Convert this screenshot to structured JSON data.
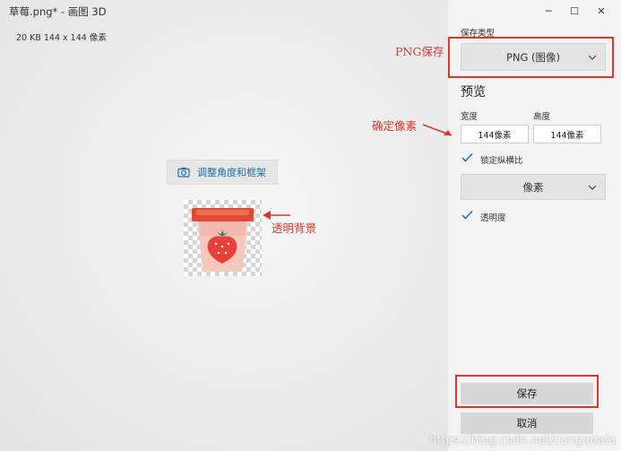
{
  "window": {
    "title": "草莓.png* - 画图 3D",
    "file_info": "20 KB   144 x 144 像素",
    "controls": {
      "minimize": "─",
      "maximize": "☐",
      "close": "✕"
    }
  },
  "canvas": {
    "crop_button_label": "调整角度和框架",
    "crop_button_icon": "camera-icon"
  },
  "panel": {
    "save_type_label": "保存类型",
    "save_type_value": "PNG (图像)",
    "preview_heading": "预览",
    "width_label": "宽度",
    "height_label": "高度",
    "width_value": "144像素",
    "height_value": "144像素",
    "lock_aspect_label": "锁定纵横比",
    "lock_aspect_checked": true,
    "unit_value": "像素",
    "transparency_label": "透明度",
    "transparency_checked": true,
    "save_button": "保存",
    "cancel_button": "取消"
  },
  "annotations": {
    "png_save": "PNG保存",
    "set_pixels": "确定像素",
    "transparent_bg": "透明背景",
    "annotation_color": "#d63a2a"
  },
  "watermark": "https://blog.csdn.net/cungudafa"
}
